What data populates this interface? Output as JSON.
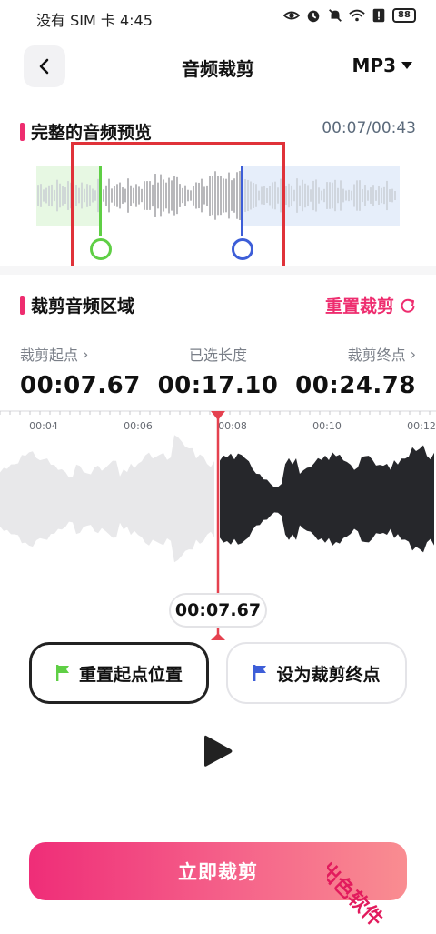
{
  "status_bar": {
    "carrier_time": "没有 SIM 卡 4:45",
    "battery": "88"
  },
  "header": {
    "title": "音频裁剪",
    "format": "MP3"
  },
  "preview": {
    "section_title": "完整的音频预览",
    "time": "00:07/00:43"
  },
  "crop": {
    "section_title": "裁剪音频区域",
    "reset_label": "重置裁剪",
    "start_label": "裁剪起点",
    "start_value": "00:07.67",
    "length_label": "已选长度",
    "length_value": "00:17.10",
    "end_label": "裁剪终点",
    "end_value": "00:24.78"
  },
  "timeline": {
    "ticks": [
      "00:04",
      "00:06",
      "00:08",
      "00:10",
      "00:12"
    ],
    "playhead_time": "00:07.67"
  },
  "actions": {
    "reset_start": "重置起点位置",
    "set_end": "设为裁剪终点",
    "cut_now": "立即裁剪"
  },
  "watermark": "出色软件",
  "colors": {
    "accent": "#ee2d6f",
    "start_marker": "#5fcf45",
    "end_marker": "#3d5ed8",
    "playhead": "#e5414f"
  }
}
